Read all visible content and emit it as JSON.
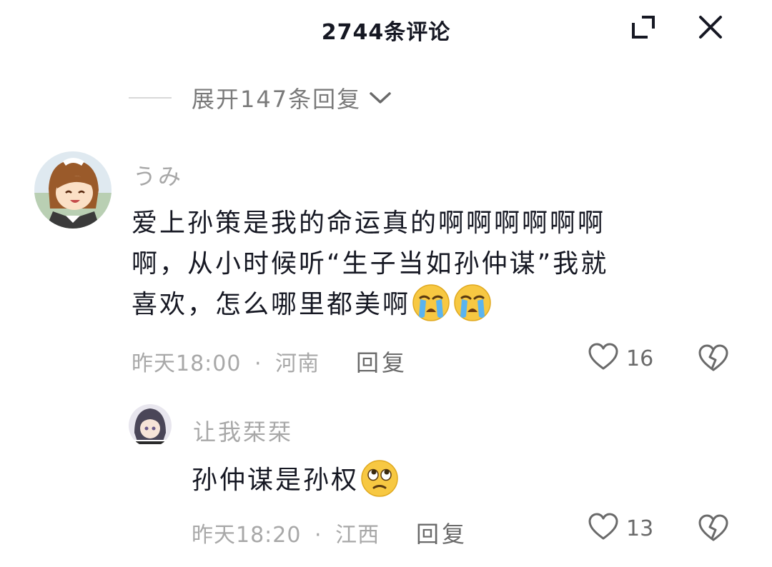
{
  "header": {
    "title": "2744条评论",
    "expand_icon": "expand-corner-icon",
    "close_icon": "close-icon"
  },
  "expand_replies": {
    "label": "展开147条回复",
    "icon": "chevron-down-icon"
  },
  "comments": [
    {
      "username": "うみ",
      "text_parts": [
        "爱上孙策是我的命运真的啊啊啊啊啊啊",
        "啊，从小时候听“生子当如孙仲谋”我就",
        "喜欢，怎么哪里都美啊"
      ],
      "emojis": [
        "crying-emoji",
        "crying-emoji"
      ],
      "time": "昨天18:00",
      "separator": "·",
      "location": "河南",
      "reply_label": "回复",
      "likes": "16",
      "like_icon": "heart-icon",
      "dislike_icon": "broken-heart-icon"
    },
    {
      "username": "让我栞栞",
      "text": "孙仲谋是孙权",
      "emojis": [
        "eye-roll-emoji"
      ],
      "time": "昨天18:20",
      "separator": "·",
      "location": "江西",
      "reply_label": "回复",
      "likes": "13",
      "like_icon": "heart-icon",
      "dislike_icon": "broken-heart-icon"
    }
  ],
  "colors": {
    "text_primary": "#161823",
    "text_secondary": "#a8a8a8",
    "text_action": "#6a6a6a"
  }
}
